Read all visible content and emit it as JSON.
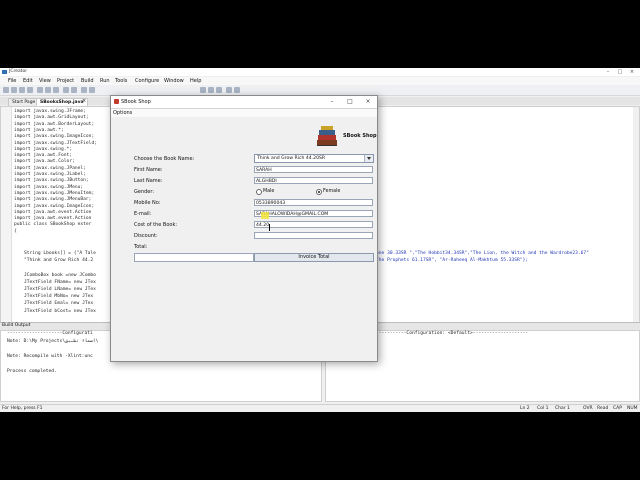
{
  "ide": {
    "title": "JCreator",
    "menu": [
      "File",
      "Edit",
      "View",
      "Project",
      "Build",
      "Run",
      "Tools",
      "Configure",
      "Window",
      "Help"
    ],
    "tabs": [
      "Start Page",
      "SBooksShop.java"
    ],
    "code_lines": [
      "import javax.swing.JFrame;",
      "import java.awt.GridLayout;",
      "import java.awt.BorderLayout;",
      "import java.awt.*;",
      "import javax.swing.ImageIcon;",
      "import javax.swing.JTextField;",
      "import javax.swing.*;",
      "import java.awt.Font;",
      "import java.awt.Color;",
      "import javax.swing.JPanel;",
      "import javax.swing.JLabel;",
      "import javax.swing.JButton;",
      "import javax.swing.JMenu;",
      "import javax.swing.JMenuItem;",
      "import javax.swing.JMenuBar;",
      "import javax.swing.ImageIcon;",
      "import java.awt.event.Action",
      "import java.awt.event.Action",
      "public class SBookShop exter",
      "{"
    ],
    "code_lines2": [
      "String Lbooks[] = {\"A Tale",
      "\"Think and Grow Rich 44.2",
      "",
      "JComboBox book =new JCombo",
      "JTextField FName= new JTex",
      "JTextField LName= new JTex",
      "JTextField MbNo= new JTex",
      "JTextField Emal= new JTex",
      "JTextField bCost= new JTex"
    ],
    "code_right1": "one 30.33SR \",\"The Hobbit34.34SR\",\"The Lion, the Witch and the Wardrobe23.67\"",
    "code_right2": "The Prophets 61.17SR\", \"Ar-Raheeq Al-Makhtum 55.33SR\"};",
    "build_header": "Build Output",
    "build_lines": [
      "--------------------Configurati",
      "Note: D:\\My Projects\\اسماء تطبيق\\",
      "",
      "Note: Recompile with -Xlint:unc",
      "",
      "Process completed."
    ],
    "build_right": "-----------Configuration: <Default>--------------------",
    "status": {
      "left": "For Help, press F1",
      "ln": "Ln 2",
      "col": "Col 1",
      "char": "Char 1",
      "ovr": "OVR",
      "read": "Read",
      "cap": "CAP",
      "num": "NUM"
    }
  },
  "dialog": {
    "title": "SBook Shop",
    "menu_label": "Options",
    "logo_text": "SBook Shop",
    "labels": {
      "book": "Choose the Book Name:",
      "first": "First Name:",
      "last": "Last Name:",
      "gender": "Gender:",
      "mobile": "Mobile No:",
      "email": "E-mail:",
      "cost": "Cost of the Book:",
      "discount": "Discount:",
      "total": "Total:"
    },
    "selected_book": "Think and Grow Rich 44.20SR",
    "first_name": "SARAH",
    "last_name": "ALGHBDI",
    "gender_male": "Male",
    "gender_female": "Female",
    "gender_selected": "Female",
    "mobile": "0533890043",
    "email": "SARAHALOWIDAH@GMAIL.COM",
    "cost": "44.20",
    "discount": "",
    "total": "",
    "invoice_button": "Invoice Total"
  }
}
